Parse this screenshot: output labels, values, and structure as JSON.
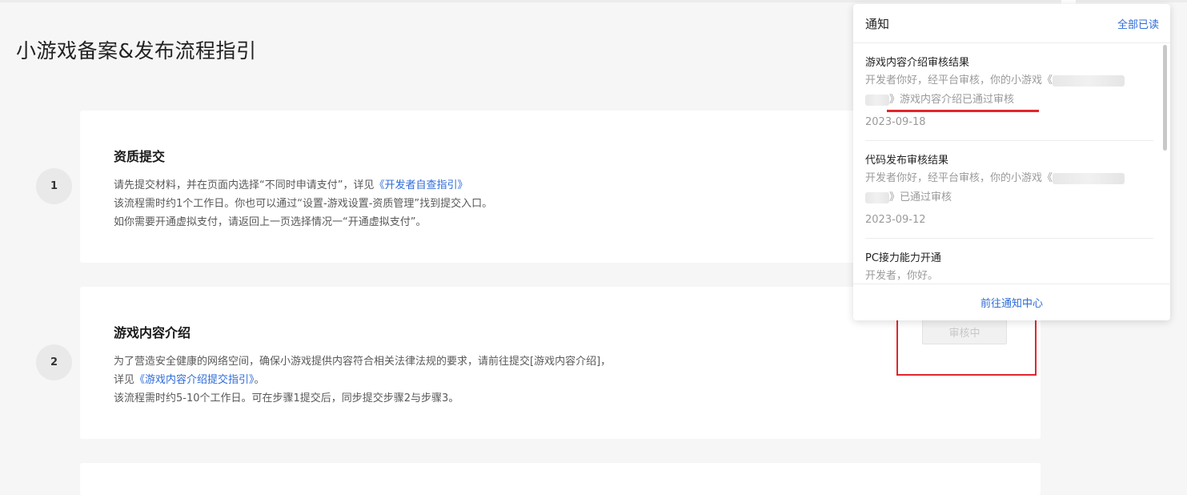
{
  "page": {
    "title": "小游戏备案&发布流程指引"
  },
  "steps": [
    {
      "number": "1",
      "title": "资质提交",
      "line1_prefix": "请先提交材料，并在页面内选择“不同时申请支付”，详见",
      "line1_link": "《开发者自查指引》",
      "line2": "该流程需时约1个工作日。你也可以通过“设置-游戏设置-资质管理”找到提交入口。",
      "line3": "如你需要开通虚拟支付，请返回上一页选择情况一“开通虚拟支付”。"
    },
    {
      "number": "2",
      "title": "游戏内容介绍",
      "line1": "为了营造安全健康的网络空间，确保小游戏提供内容符合相关法律法规的要求，请前往提交[游戏内容介绍]，",
      "line2_prefix": "详见",
      "line2_link": "《游戏内容介绍提交指引》",
      "line2_suffix": "。",
      "line3": "该流程需时约5-10个工作日。可在步骤1提交后，同步提交步骤2与步骤3。",
      "status_label": "审核中"
    }
  ],
  "notifications": {
    "title": "通知",
    "mark_all_read": "全部已读",
    "items": [
      {
        "title": "游戏内容介绍审核结果",
        "body_prefix": "开发者你好，经平台审核，你的小游戏《",
        "body_suffix": "》游戏内容介绍已通过审核",
        "date": "2023-09-18"
      },
      {
        "title": "代码发布审核结果",
        "body_prefix": "开发者你好，经平台审核，你的小游戏《",
        "body_suffix": "》已通过审核",
        "date": "2023-09-12"
      },
      {
        "title": "PC接力能力开通",
        "body": "开发者，你好。"
      }
    ],
    "footer_link": "前往通知中心"
  },
  "colors": {
    "link": "#2e6bd8",
    "highlight": "#e0262d",
    "background": "#f6f6f6"
  }
}
